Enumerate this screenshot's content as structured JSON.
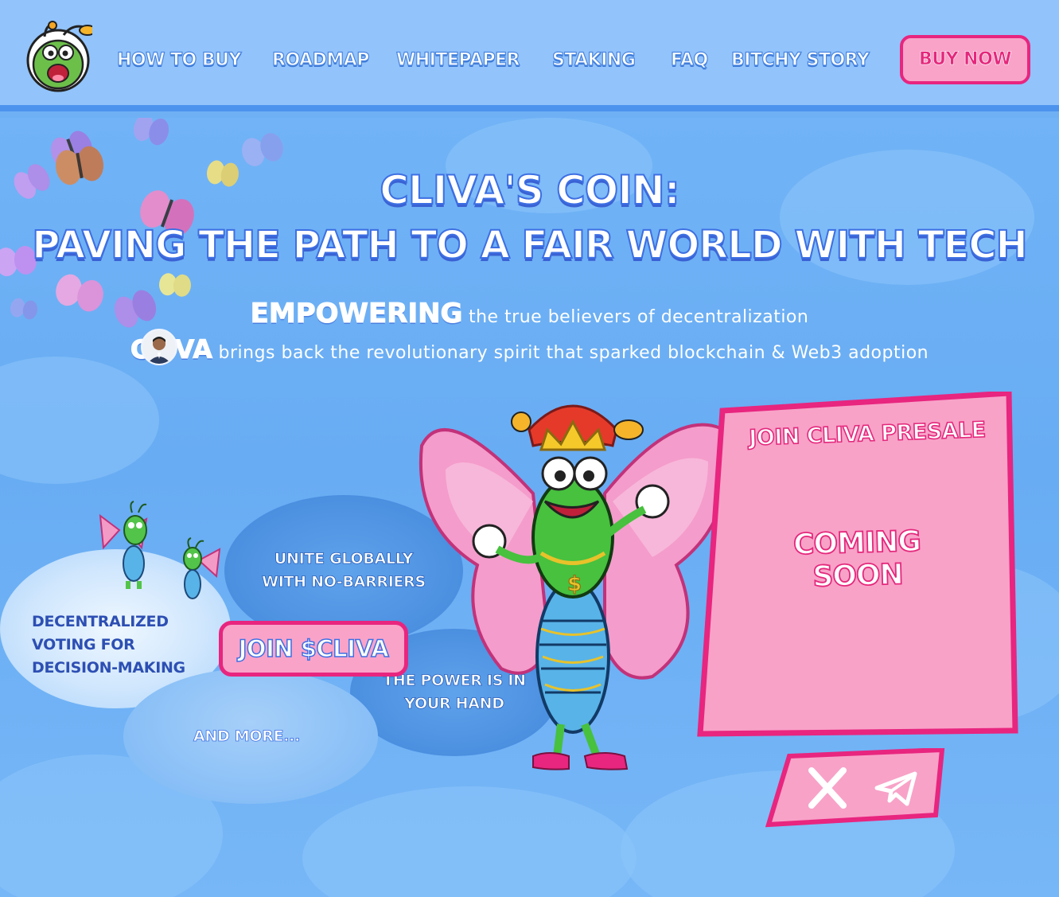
{
  "header": {
    "nav": [
      {
        "label": "HOW TO BUY"
      },
      {
        "label": "ROADMAP"
      },
      {
        "label": "WHITEPAPER"
      },
      {
        "label": "STAKING"
      },
      {
        "label": "FAQ"
      },
      {
        "label": "BITCHY STORY"
      }
    ],
    "buy_label": "BUY NOW"
  },
  "hero": {
    "title_line1": "CLIVA'S COIN:",
    "title_line2": "PAVING THE PATH TO A FAIR WORLD WITH TECH",
    "tag1_big": "EMPOWERING",
    "tag1_small": " the true believers of decentralization",
    "tag2_big": "CLIVA",
    "tag2_small": " brings back the revolutionary spirit that sparked blockchain & Web3 adoption"
  },
  "features": {
    "voting": "DECENTRALIZED VOTING FOR DECISION-MAKING",
    "unite": "UNITE GLOBALLY WITH NO-BARRIERS",
    "power": "THE POWER IS IN YOUR HAND",
    "more": "AND MORE..."
  },
  "cta": {
    "join_label": "JOIN $CLIVA"
  },
  "presale": {
    "title": "JOIN CLIVA PRESALE",
    "status": "COMING SOON"
  },
  "socials": {
    "x_icon": "x-logo-icon",
    "telegram_icon": "telegram-icon"
  },
  "colors": {
    "accent_pink": "#e8257f",
    "panel_pink": "#f9a3c9",
    "header_blue": "#92c3fb",
    "sky_blue": "#6fb0f5"
  }
}
